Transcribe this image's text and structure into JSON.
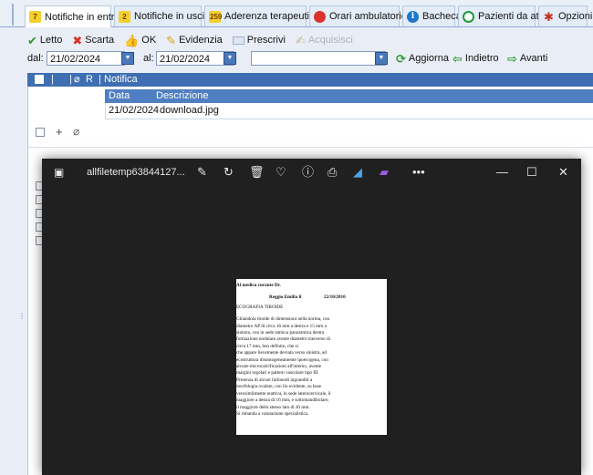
{
  "tabs": [
    {
      "badge": "7",
      "label": "Notifiche in entrata",
      "active": true
    },
    {
      "badge": "2",
      "label": "Notifiche in uscita",
      "active": false
    },
    {
      "badge": "259",
      "label": "Aderenza terapeutica",
      "active": false
    },
    {
      "label": "Orari ambulatorio",
      "icon": "record-icon"
    },
    {
      "label": "Bacheca",
      "icon": "info-icon"
    },
    {
      "label": "Pazienti da attivare",
      "icon": "power-icon"
    },
    {
      "label": "Opzioni",
      "icon": "gear-icon"
    }
  ],
  "toolbar": {
    "letto": "Letto",
    "scarta": "Scarta",
    "ok": "OK",
    "evidenzia": "Evidenzia",
    "prescrivi": "Prescrivi",
    "acquisisci": "Acquisisci"
  },
  "filters": {
    "dal_label": "dal:",
    "dal_value": "21/02/2024",
    "al_label": "al:",
    "al_value": "21/02/2024",
    "select_value": "",
    "aggiorna": "Aggiorna",
    "indietro": "Indietro",
    "avanti": "Avanti"
  },
  "grid": {
    "col_r": "R",
    "col_notifica": "Notifica",
    "sub_col_data": "Data",
    "sub_col_descrizione": "Descrizione",
    "row": {
      "data": "21/02/2024",
      "descrizione": "download.jpg"
    }
  },
  "viewer": {
    "title": "allfiletemp63844127...",
    "minimize": "—",
    "maximize": "☐",
    "close": "✕"
  },
  "document": {
    "heading": "Al medico curante Dr.",
    "place": "Reggio Emilia li",
    "date": "22/10/2010",
    "title": "ECOGRAFIA TIROIDE",
    "body": [
      "Ghiandola tiroide di dimensioni nella norma, con",
      "diametro AP di circa 16 mm a destra e 15 mm a",
      "sinistra, con in sede istmica paraistmica destra",
      "formazione nodulare avente diametro trasverso di",
      "circa 17 mm, ben definito, che si",
      "che appare lievemente deviata verso sinistra, ad",
      "ecostruttura disomogeneamente ipoecogena, con",
      "alcune microcalcificazioni all'interno, avente",
      "margini regolari e pattern vascolare tipo III.",
      "Presenza di alcuni linfonodi ingranditi a",
      "morfologia ovalare, con ilo evidente, su base",
      "verosimilmente reattiva, in sede laterocervicale, il",
      "maggiore a destra di 16 mm, e sottomandibolare,",
      "il maggiore dello stesso lato di 20 mm.",
      "Si rimanda a valutazione specialistica."
    ]
  }
}
